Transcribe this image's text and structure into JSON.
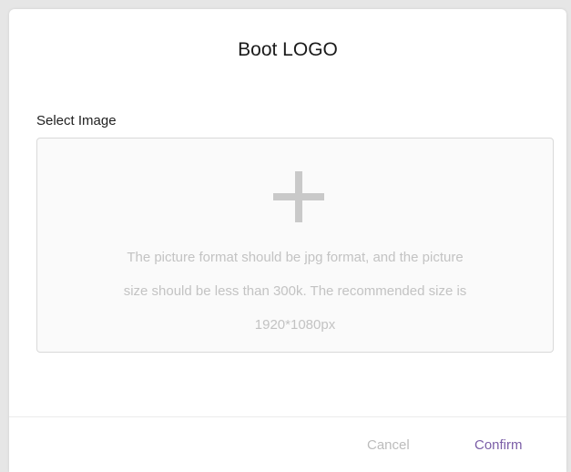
{
  "dialog": {
    "title": "Boot LOGO",
    "section_label": "Select Image",
    "upload": {
      "icon": "plus-icon",
      "hint_line1": "The picture format should be jpg format, and the picture",
      "hint_line2": "size should be less than 300k. The recommended size is",
      "hint_line3": "1920*1080px"
    },
    "buttons": {
      "cancel_label": "Cancel",
      "confirm_label": "Confirm"
    }
  },
  "colors": {
    "accent": "#7b5ea7",
    "muted_text": "#c3c3c3",
    "border": "#d9d9d9"
  }
}
